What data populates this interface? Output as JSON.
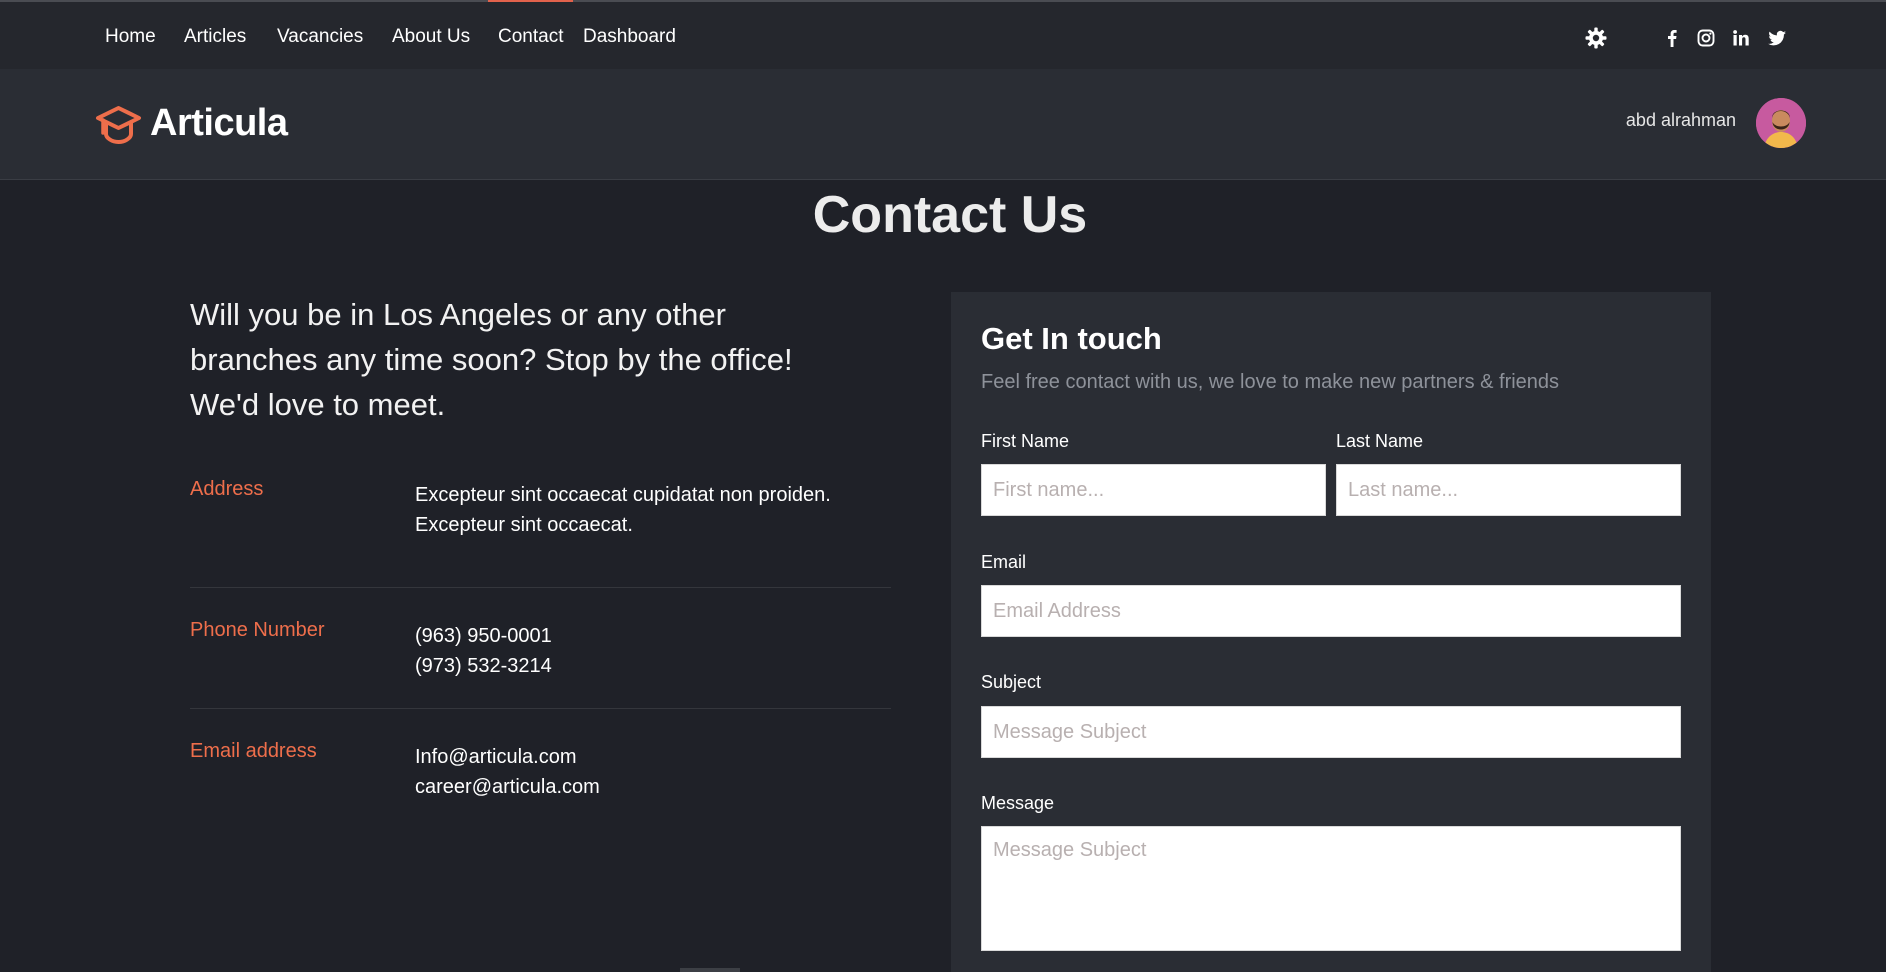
{
  "nav": {
    "items": [
      {
        "label": "Home"
      },
      {
        "label": "Articles"
      },
      {
        "label": "Vacancies"
      },
      {
        "label": "About Us"
      },
      {
        "label": "Contact",
        "active": true
      },
      {
        "label": "Dashboard"
      }
    ],
    "icons": [
      "settings-icon",
      "facebook-icon",
      "instagram-icon",
      "linkedin-icon",
      "twitter-icon"
    ]
  },
  "header": {
    "logo_text": "Articula",
    "user_name": "abd alrahman"
  },
  "page": {
    "title": "Contact Us",
    "intro": "Will you be in Los Angeles or any other branches any time soon? Stop by the office! We'd love to meet."
  },
  "contact_info": {
    "address": {
      "label": "Address",
      "line1": "Excepteur sint occaecat cupidatat non proiden.",
      "line2": "Excepteur sint occaecat."
    },
    "phone": {
      "label": "Phone Number",
      "line1": "(963) 950-0001",
      "line2": "(973) 532-3214"
    },
    "email": {
      "label": "Email address",
      "line1": "Info@articula.com",
      "line2": "career@articula.com"
    }
  },
  "form": {
    "title": "Get In touch",
    "subtitle": "Feel free contact with us, we love to make new partners & friends",
    "first_name": {
      "label": "First Name",
      "placeholder": "First name...",
      "value": ""
    },
    "last_name": {
      "label": "Last Name",
      "placeholder": "Last name...",
      "value": ""
    },
    "email": {
      "label": "Email",
      "placeholder": "Email Address",
      "value": ""
    },
    "subject": {
      "label": "Subject",
      "placeholder": "Message Subject",
      "value": ""
    },
    "message": {
      "label": "Message",
      "placeholder": "Message Subject",
      "value": ""
    }
  },
  "colors": {
    "accent": "#ee6e4b",
    "background": "#1f2128",
    "card": "#2a2d34"
  }
}
